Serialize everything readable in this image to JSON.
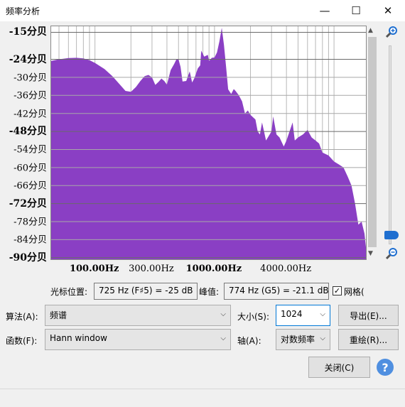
{
  "window": {
    "title": "频率分析"
  },
  "y_axis": {
    "labels": [
      {
        "text": "-15分贝",
        "bold": true,
        "db": -15
      },
      {
        "text": "-24分贝",
        "bold": true,
        "db": -24
      },
      {
        "text": "-30分贝",
        "bold": false,
        "db": -30
      },
      {
        "text": "-36分贝",
        "bold": false,
        "db": -36
      },
      {
        "text": "-42分贝",
        "bold": false,
        "db": -42
      },
      {
        "text": "-48分贝",
        "bold": true,
        "db": -48
      },
      {
        "text": "-54分贝",
        "bold": false,
        "db": -54
      },
      {
        "text": "-60分贝",
        "bold": false,
        "db": -60
      },
      {
        "text": "-66分贝",
        "bold": false,
        "db": -66
      },
      {
        "text": "-72分贝",
        "bold": true,
        "db": -72
      },
      {
        "text": "-78分贝",
        "bold": false,
        "db": -78
      },
      {
        "text": "-84分贝",
        "bold": false,
        "db": -84
      },
      {
        "text": "-90分贝",
        "bold": true,
        "db": -90
      }
    ]
  },
  "x_axis": {
    "labels": [
      {
        "text": "100.00Hz",
        "bold": true,
        "hz": 100
      },
      {
        "text": "300.00Hz",
        "bold": false,
        "hz": 300
      },
      {
        "text": "1000.00Hz",
        "bold": true,
        "hz": 1000
      },
      {
        "text": "4000.00Hz",
        "bold": false,
        "hz": 4000
      }
    ]
  },
  "chart_data": {
    "type": "area",
    "x_scale": "log",
    "xlim_hz": [
      43,
      19000
    ],
    "ylim_db": [
      -91,
      -13
    ],
    "fill_color": "#8a3fc4",
    "grid": true,
    "points": [
      [
        43,
        -24.5
      ],
      [
        50,
        -24
      ],
      [
        60,
        -23.6
      ],
      [
        70,
        -23.5
      ],
      [
        80,
        -23.7
      ],
      [
        90,
        -24.3
      ],
      [
        100,
        -25.2
      ],
      [
        120,
        -27.2
      ],
      [
        140,
        -29.6
      ],
      [
        160,
        -32.2
      ],
      [
        180,
        -34.5
      ],
      [
        200,
        -34.8
      ],
      [
        220,
        -33.2
      ],
      [
        240,
        -31.2
      ],
      [
        260,
        -29.6
      ],
      [
        280,
        -29.2
      ],
      [
        300,
        -30
      ],
      [
        320,
        -32.5
      ],
      [
        340,
        -31.5
      ],
      [
        360,
        -30.4
      ],
      [
        380,
        -31.2
      ],
      [
        400,
        -32.4
      ],
      [
        430,
        -27.6
      ],
      [
        460,
        -25.5
      ],
      [
        480,
        -24
      ],
      [
        500,
        -24
      ],
      [
        520,
        -26.5
      ],
      [
        540,
        -31.4
      ],
      [
        580,
        -31.2
      ],
      [
        620,
        -28
      ],
      [
        650,
        -31.7
      ],
      [
        680,
        -30.2
      ],
      [
        725,
        -27
      ],
      [
        760,
        -26
      ],
      [
        774,
        -21.1
      ],
      [
        820,
        -23.1
      ],
      [
        880,
        -22.5
      ],
      [
        900,
        -24.5
      ],
      [
        950,
        -23.5
      ],
      [
        1000,
        -23.4
      ],
      [
        1050,
        -21.7
      ],
      [
        1100,
        -18
      ],
      [
        1150,
        -13.5
      ],
      [
        1200,
        -19.2
      ],
      [
        1250,
        -26.5
      ],
      [
        1300,
        -34
      ],
      [
        1380,
        -35.5
      ],
      [
        1450,
        -33.9
      ],
      [
        1500,
        -34.5
      ],
      [
        1600,
        -36
      ],
      [
        1700,
        -38
      ],
      [
        1800,
        -42
      ],
      [
        1900,
        -41
      ],
      [
        2000,
        -42.5
      ],
      [
        2200,
        -44
      ],
      [
        2300,
        -48
      ],
      [
        2400,
        -49
      ],
      [
        2500,
        -45
      ],
      [
        2700,
        -51
      ],
      [
        3000,
        -48
      ],
      [
        3100,
        -43
      ],
      [
        3300,
        -49
      ],
      [
        3500,
        -50
      ],
      [
        3800,
        -53
      ],
      [
        4000,
        -51
      ],
      [
        4500,
        -45
      ],
      [
        4700,
        -51
      ],
      [
        5000,
        -50
      ],
      [
        5500,
        -49
      ],
      [
        6000,
        -47.5
      ],
      [
        6500,
        -50
      ],
      [
        7000,
        -51
      ],
      [
        7500,
        -52
      ],
      [
        8000,
        -55
      ],
      [
        9000,
        -56
      ],
      [
        10000,
        -58
      ],
      [
        11000,
        -59
      ],
      [
        12000,
        -60
      ],
      [
        13000,
        -63
      ],
      [
        14000,
        -66
      ],
      [
        15000,
        -72
      ],
      [
        16000,
        -79
      ],
      [
        17000,
        -78
      ],
      [
        18000,
        -82
      ],
      [
        19000,
        -91
      ]
    ]
  },
  "cursor_info": {
    "cursor_label": "光标位置:",
    "cursor_value": "725 Hz (F♯5) = -25 dB",
    "peak_label": "峰值:",
    "peak_value": "774 Hz (G5) = -21.1 dB",
    "grid_label": "网格(",
    "grid_checked": true
  },
  "controls": {
    "algorithm_label": "算法(A):",
    "algorithm_value": "频谱",
    "size_label": "大小(S):",
    "size_value": "1024",
    "function_label": "函数(F):",
    "function_value": "Hann window",
    "axis_label": "轴(A):",
    "axis_value": "对数频率",
    "export_label": "导出(E)...",
    "replot_label": "重绘(R)...",
    "close_label": "关闭(C)",
    "help_label": "?"
  },
  "colors": {
    "spectrum": "#8a3fc4",
    "zoom_thumb": "#1f6fd0",
    "help": "#4f8fe0"
  }
}
